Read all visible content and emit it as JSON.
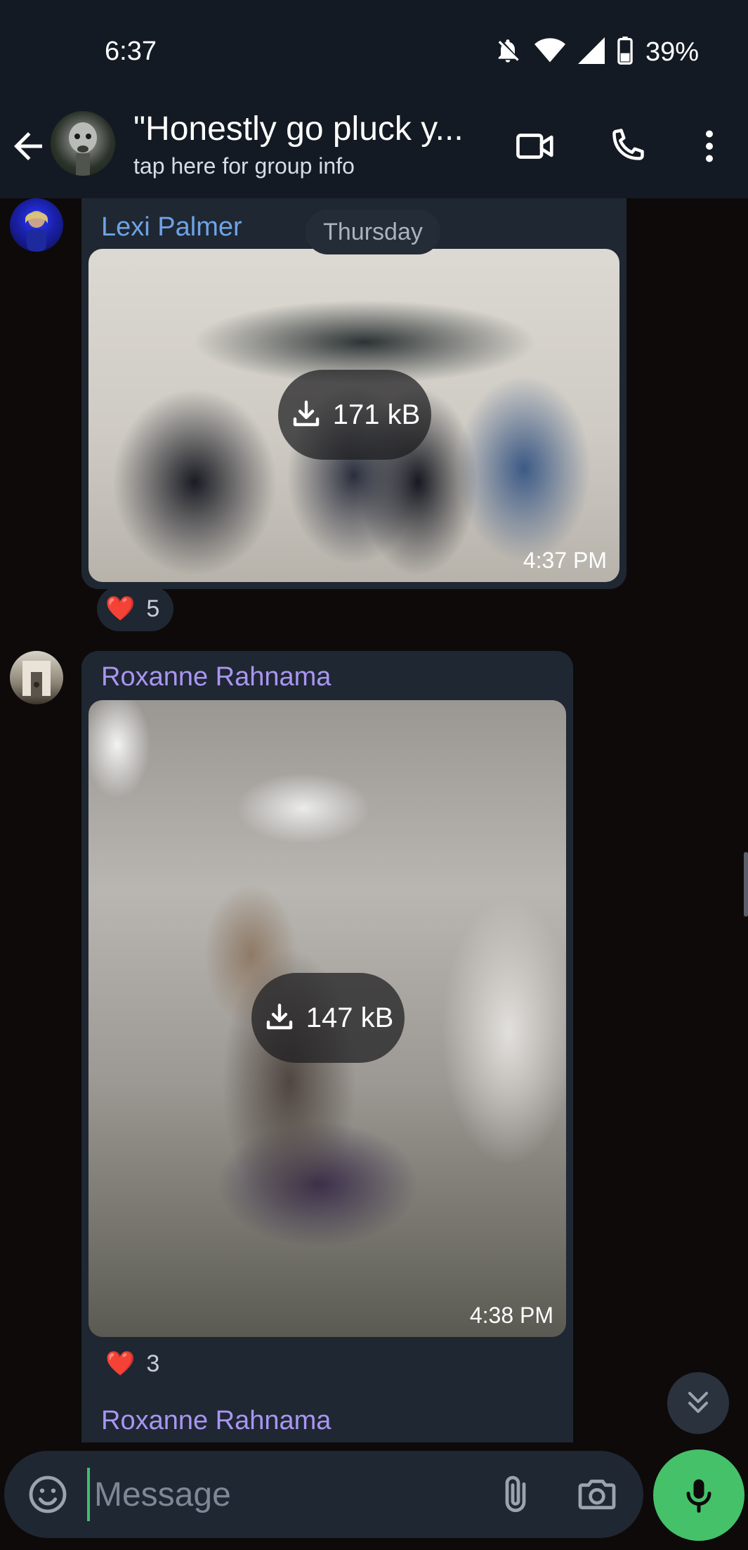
{
  "status_bar": {
    "time": "6:37",
    "battery": "39%",
    "icons": [
      "bell-off-icon",
      "wifi-icon",
      "signal-icon",
      "battery-icon"
    ]
  },
  "header": {
    "title": "\"Honestly go pluck y...",
    "subtitle": "tap here for group info",
    "actions": [
      "video-call-icon",
      "phone-icon",
      "more-vert-icon"
    ]
  },
  "chat": {
    "day_chip": "Thursday",
    "messages": [
      {
        "sender": "Lexi Palmer",
        "size": "171 kB",
        "time": "4:37 PM",
        "reaction_emoji": "❤️",
        "reaction_count": "5"
      },
      {
        "sender": "Roxanne Rahnama",
        "size": "147 kB",
        "time": "4:38 PM",
        "reaction_emoji": "❤️",
        "reaction_count": "3"
      },
      {
        "sender": "Roxanne Rahnama"
      }
    ]
  },
  "composer": {
    "placeholder": "Message"
  },
  "colors": {
    "accent_green": "#45c16a",
    "lexi_name": "#6ea3e6",
    "roxanne_name": "#a995f2",
    "bubble": "#1f2732",
    "header": "#141a23"
  }
}
